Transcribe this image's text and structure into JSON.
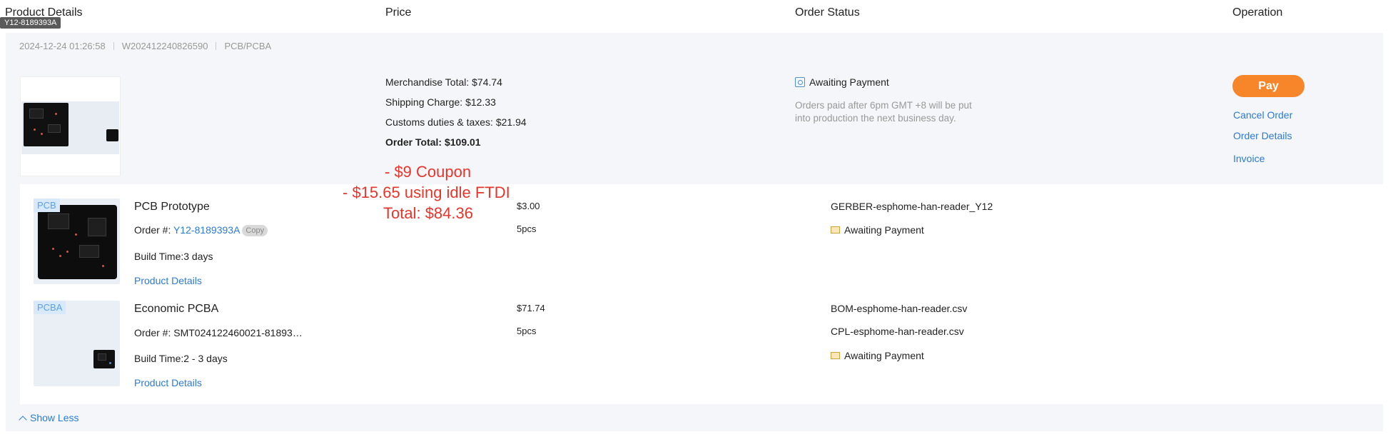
{
  "headers": {
    "product_details": "Product Details",
    "price": "Price",
    "order_status": "Order Status",
    "operation": "Operation"
  },
  "tooltip": "Y12-8189393A",
  "order": {
    "date": "2024-12-24 01:26:58",
    "number": "W202412240826590",
    "type": "PCB/PCBA",
    "merchandise_total": "Merchandise Total: $74.74",
    "shipping_charge": "Shipping Charge: $12.33",
    "customs": "Customs duties & taxes: $21.94",
    "order_total": "Order Total: $109.01",
    "status": "Awaiting Payment",
    "note_line1": "Orders paid after 6pm GMT +8 will be put",
    "note_line2": "into production the next business day.",
    "pay_label": "Pay",
    "cancel_label": "Cancel Order",
    "details_label": "Order Details",
    "invoice_label": "Invoice"
  },
  "annotation": {
    "line1": "- $9 Coupon",
    "line2": "- $15.65 using idle FTDI",
    "line3": "Total: $84.36"
  },
  "items": [
    {
      "tag": "PCB",
      "title": "PCB Prototype",
      "order_prefix": "Order #: ",
      "order_no": "Y12-8189393A",
      "copy_label": "Copy",
      "build_time": "Build Time:3 days",
      "details_link": "Product Details",
      "price": "$3.00",
      "qty": "5pcs",
      "file1": "GERBER-esphome-han-reader_Y12",
      "status": "Awaiting Payment"
    },
    {
      "tag": "PCBA",
      "title": "Economic PCBA",
      "order_text": "Order #: SMT024122460021-81893…",
      "build_time": "Build Time:2 - 3 days",
      "details_link": "Product Details",
      "price": "$71.74",
      "qty": "5pcs",
      "file1": "BOM-esphome-han-reader.csv",
      "file2": "CPL-esphome-han-reader.csv",
      "status": "Awaiting Payment"
    }
  ],
  "show_less": "Show Less",
  "colors": {
    "accent_blue": "#2a7bd8",
    "pay_orange": "#f7852a",
    "annotation_red": "#e8352c",
    "tag_bg": "#d7e9fb"
  }
}
